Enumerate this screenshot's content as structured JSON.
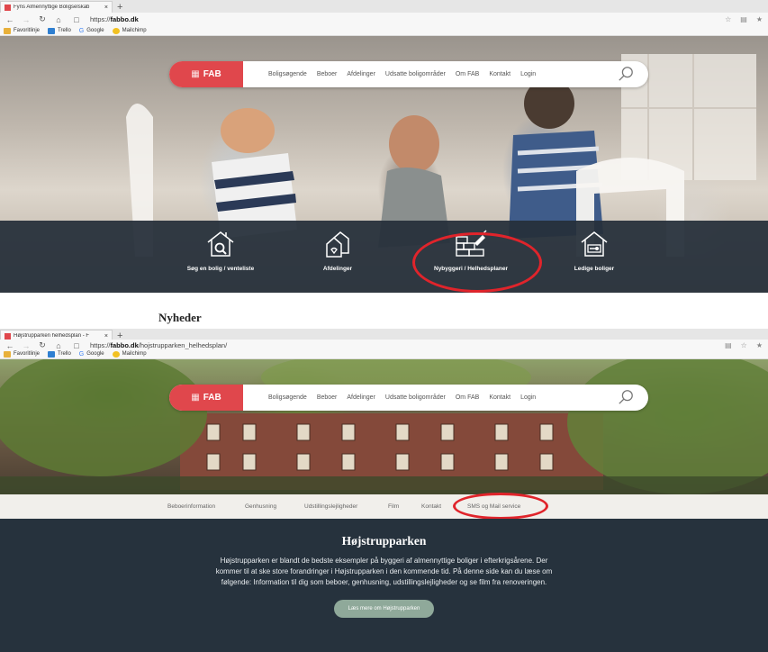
{
  "screen1": {
    "tab": {
      "title": "Fyns Almennyttige Boligselskab",
      "close": "×",
      "new": "+"
    },
    "address": {
      "prefix": "https://",
      "host": "fabbo.dk",
      "path": ""
    },
    "favorites": [
      {
        "label": "Favoritlinje",
        "color": "#e8b03a"
      },
      {
        "label": "Trello",
        "color": "#2f7fd1"
      },
      {
        "label": "Google",
        "color": "#ffffff",
        "glyph": "G"
      },
      {
        "label": "Mailchimp",
        "color": "#f2c122"
      }
    ],
    "nav": {
      "logo": "FAB",
      "links": [
        "Boligsøgende",
        "Beboer",
        "Afdelinger",
        "Udsatte boligområder",
        "Om FAB",
        "Kontakt",
        "Login"
      ]
    },
    "categories": [
      {
        "label": "Søg en bolig / venteliste",
        "icon": "house-search-icon"
      },
      {
        "label": "Afdelinger",
        "icon": "buildings-icon"
      },
      {
        "label": "Nybyggeri / Helhedsplaner",
        "icon": "brick-trowel-icon"
      },
      {
        "label": "Ledige boliger",
        "icon": "house-key-icon"
      }
    ],
    "news_heading": "Nyheder"
  },
  "screen2": {
    "tab": {
      "title": "Højstrupparken helhedsplan - F",
      "close": "×",
      "new": "+"
    },
    "address": {
      "prefix": "https://",
      "host": "fabbo.dk",
      "path": "/hojstrupparken_helhedsplan/"
    },
    "nav": {
      "logo": "FAB",
      "links": [
        "Boligsøgende",
        "Beboer",
        "Afdelinger",
        "Udsatte boligområder",
        "Om FAB",
        "Kontakt",
        "Login"
      ]
    },
    "subnav": [
      "Beboerinformation",
      "Genhusning",
      "Udstillingslejligheder",
      "Film",
      "Kontakt",
      "SMS og Mail service"
    ],
    "content": {
      "title": "Højstrupparken",
      "text": "Højstrupparken er blandt de bedste eksempler på byggeri af almennyttige boliger i efterkrigsårene. Der kommer til at ske store forandringer i Højstrupparken i den kommende tid. På denne side kan du læse om følgende: Information til dig som beboer, genhusning, udstillingslejligheder og se film fra renoveringen.",
      "button": "Læs mere om Højstrupparken"
    }
  },
  "colors": {
    "brand": "#e0474c",
    "dark": "#26323d",
    "highlight": "#e0242b",
    "button": "#8fa99a"
  }
}
